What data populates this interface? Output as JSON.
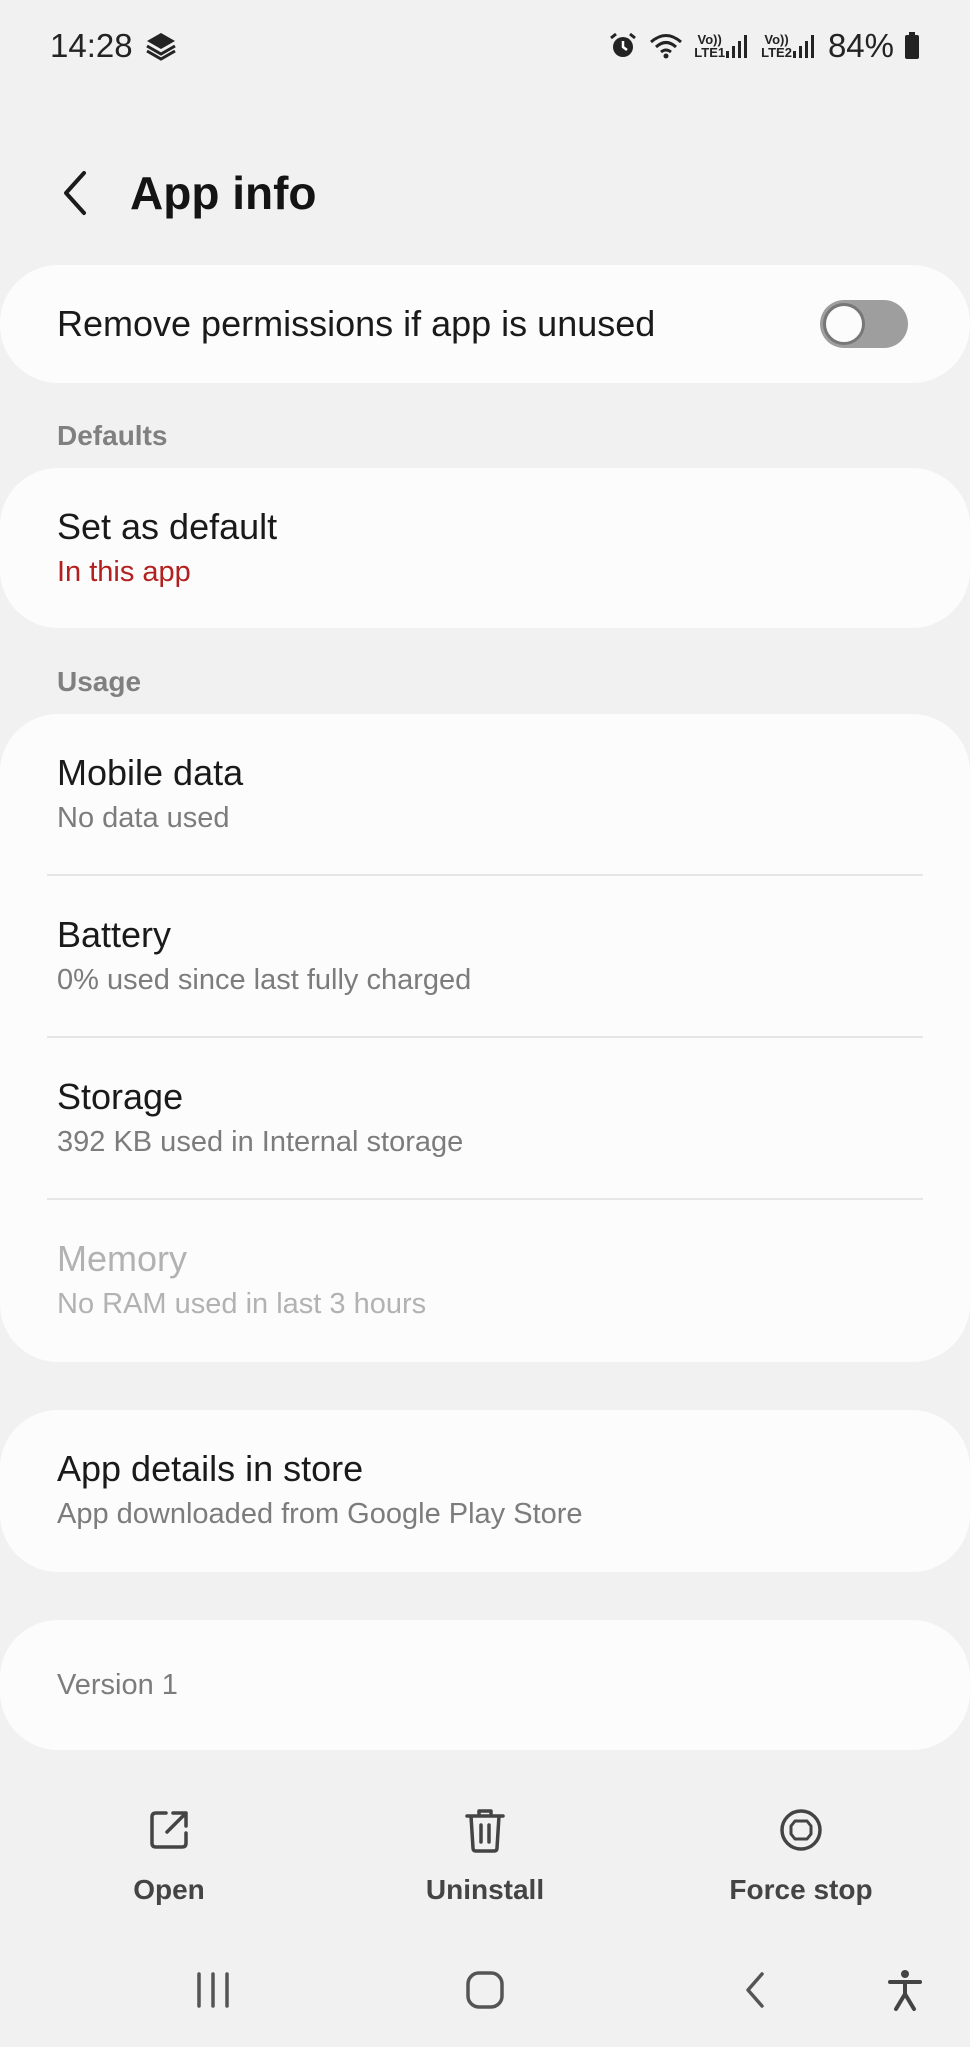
{
  "status_bar": {
    "time": "14:28",
    "sim1_top": "Vo))",
    "sim1_bottom": "LTE1",
    "sim2_top": "Vo))",
    "sim2_bottom": "LTE2",
    "battery": "84%"
  },
  "header": {
    "title": "App info"
  },
  "permissions": {
    "label": "Remove permissions if app is unused",
    "toggle_on": false
  },
  "defaults": {
    "section": "Defaults",
    "title": "Set as default",
    "subtitle": "In this app",
    "subtitle_color": "#b32020"
  },
  "usage": {
    "section": "Usage",
    "items": [
      {
        "title": "Mobile data",
        "subtitle": "No data used"
      },
      {
        "title": "Battery",
        "subtitle": "0% used since last fully charged"
      },
      {
        "title": "Storage",
        "subtitle": "392 KB used in Internal storage"
      },
      {
        "title": "Memory",
        "subtitle": "No RAM used in last 3 hours"
      }
    ]
  },
  "store": {
    "title": "App details in store",
    "subtitle": "App downloaded from Google Play Store"
  },
  "version": {
    "label": "Version 1"
  },
  "actions": {
    "open": "Open",
    "uninstall": "Uninstall",
    "force_stop": "Force stop"
  },
  "icons": {
    "alarm": "alarm-icon",
    "wifi": "wifi-icon",
    "signal": "signal-icon",
    "battery": "battery-icon",
    "back": "chevron-left-icon",
    "open": "open-external-icon",
    "uninstall": "trash-icon",
    "force_stop": "stop-icon",
    "recents": "recents-icon",
    "home": "home-icon",
    "nav_back": "back-icon",
    "accessibility": "accessibility-icon"
  }
}
